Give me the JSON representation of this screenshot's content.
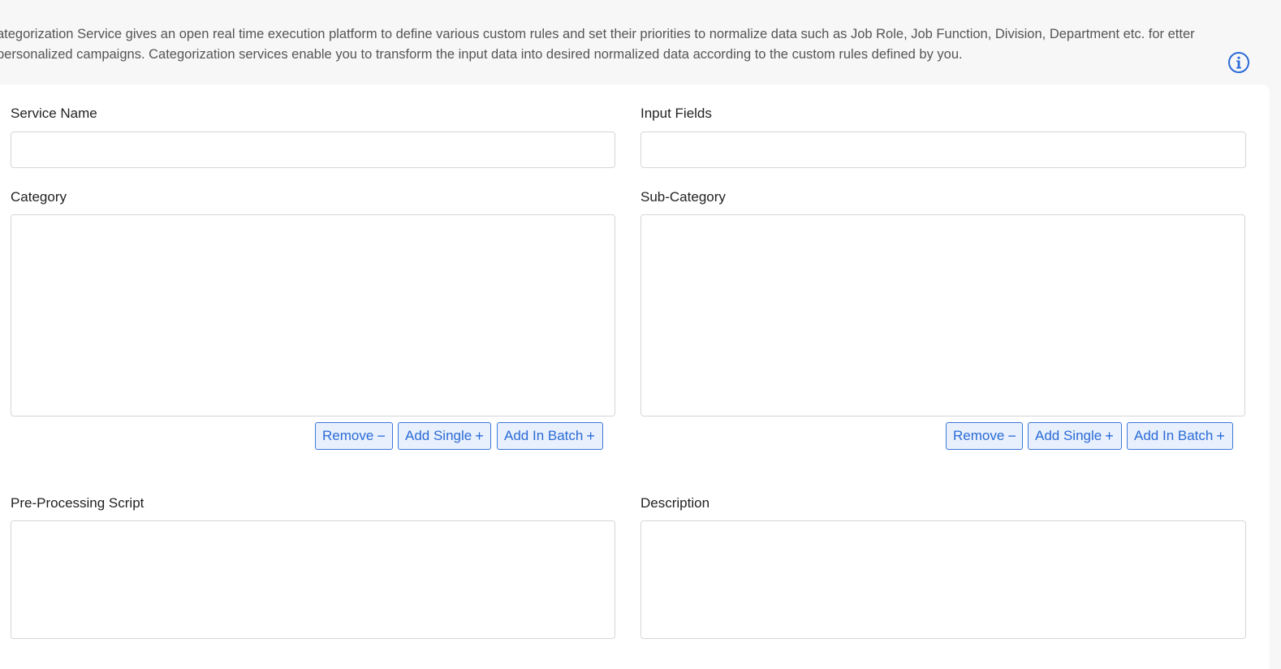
{
  "intro": {
    "text": "ategorization Service gives an open real time execution platform to define various custom rules and set their priorities to normalize data such as Job Role, Job Function, Division, Department etc. for etter personalized campaigns. Categorization services enable you to transform the input data into desired normalized data according to the custom rules defined by you."
  },
  "icons": {
    "info": "info-circle-icon",
    "minus": "minus-icon",
    "plus": "plus-icon"
  },
  "colors": {
    "accent": "#2a6bd6",
    "button_bg": "#e8f0fd",
    "page_bg": "#f7f7f8"
  },
  "form": {
    "service_name": {
      "label": "Service Name",
      "value": ""
    },
    "input_fields": {
      "label": "Input Fields",
      "value": ""
    },
    "category": {
      "label": "Category",
      "value": "",
      "remove_label": "Remove",
      "add_single_label": "Add Single",
      "add_batch_label": "Add In Batch"
    },
    "sub_category": {
      "label": "Sub-Category",
      "value": "",
      "remove_label": "Remove",
      "add_single_label": "Add Single",
      "add_batch_label": "Add In Batch"
    },
    "pre_processing_script": {
      "label": "Pre-Processing Script",
      "value": ""
    },
    "description": {
      "label": "Description",
      "value": ""
    }
  },
  "glyphs": {
    "minus": "−",
    "plus": "+"
  }
}
